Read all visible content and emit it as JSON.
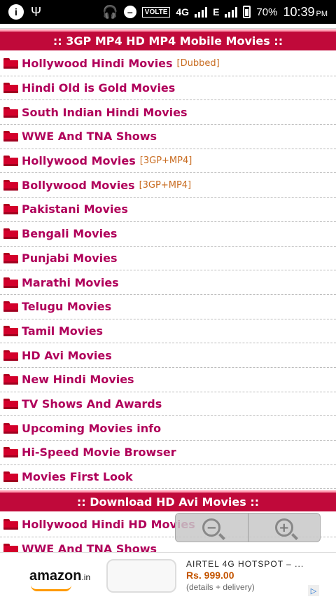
{
  "status_bar": {
    "volte": "VOLTE",
    "network": "4G",
    "data_letter": "E",
    "battery": "70%",
    "time": "10:39",
    "ampm": "PM",
    "battery_level": 0.7,
    "icons": [
      "info-icon",
      "usb-icon",
      "headphone-icon",
      "do-not-disturb-icon",
      "signal-icon",
      "battery-icon"
    ]
  },
  "section1": {
    "title": ":: 3GP MP4 HD MP4 Mobile Movies ::",
    "items": [
      {
        "label": "Hollywood Hindi Movies",
        "badge": "[Dubbed]"
      },
      {
        "label": "Hindi Old is Gold Movies",
        "badge": ""
      },
      {
        "label": "South Indian Hindi Movies",
        "badge": ""
      },
      {
        "label": "WWE And TNA Shows",
        "badge": ""
      },
      {
        "label": "Hollywood Movies",
        "badge": "[3GP+MP4]"
      },
      {
        "label": "Bollywood Movies",
        "badge": "[3GP+MP4]"
      },
      {
        "label": "Pakistani Movies",
        "badge": ""
      },
      {
        "label": "Bengali Movies",
        "badge": ""
      },
      {
        "label": "Punjabi Movies",
        "badge": ""
      },
      {
        "label": "Marathi Movies",
        "badge": ""
      },
      {
        "label": "Telugu Movies",
        "badge": ""
      },
      {
        "label": "Tamil Movies",
        "badge": ""
      },
      {
        "label": "HD Avi Movies",
        "badge": ""
      },
      {
        "label": "New Hindi Movies",
        "badge": ""
      },
      {
        "label": "TV Shows And Awards",
        "badge": ""
      },
      {
        "label": "Upcoming Movies info",
        "badge": ""
      },
      {
        "label": "Hi-Speed Movie Browser",
        "badge": ""
      },
      {
        "label": "Movies First Look",
        "badge": ""
      }
    ]
  },
  "section2": {
    "title": ":: Download HD Avi Movies ::",
    "items": [
      {
        "label": "Hollywood Hindi HD Movies",
        "badge": ""
      },
      {
        "label": "WWE And TNA Shows",
        "badge": ""
      }
    ]
  },
  "zoom": {
    "out_symbol": "−",
    "in_symbol": "+"
  },
  "ad": {
    "logo": "amazon",
    "logo_suffix": ".in",
    "title": "AIRTEL 4G HOTSPOT – ...",
    "price": "Rs. 999.00",
    "sub": "(details + delivery)",
    "badge": "▷"
  }
}
